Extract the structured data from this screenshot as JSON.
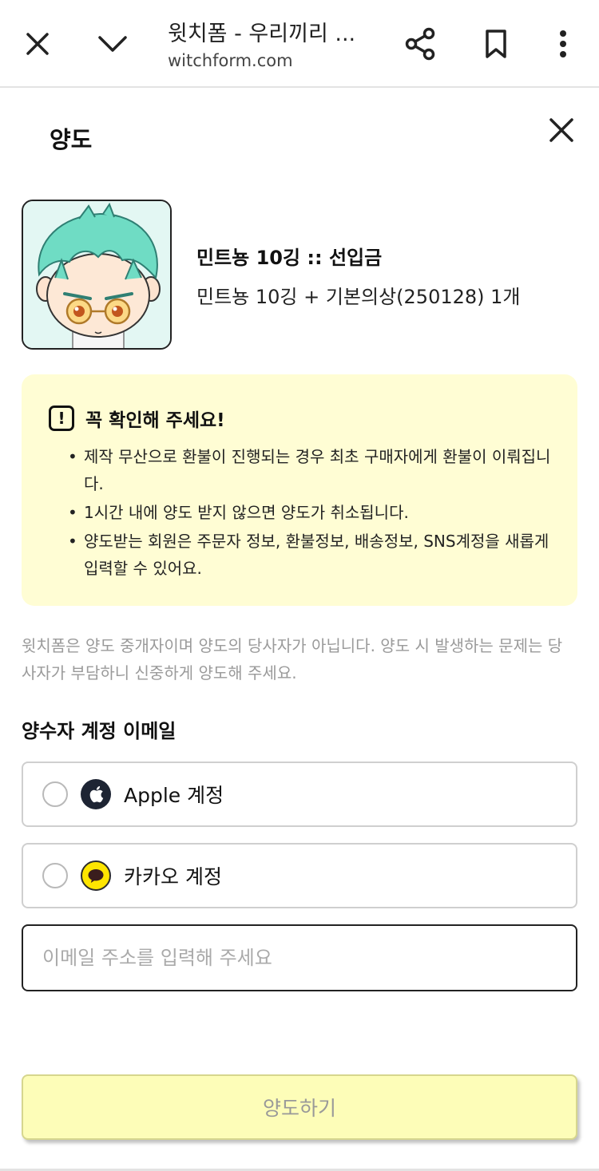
{
  "browser": {
    "title": "윗치폼 - 우리끼리 ...",
    "url": "witchform.com"
  },
  "page": {
    "title": "양도"
  },
  "product": {
    "name": "민트뇽 10깅 :: 선입금",
    "option": "민트뇽 10깅 + 기본의상(250128) 1개"
  },
  "notice": {
    "title": "꼭 확인해 주세요!",
    "items": [
      "제작 무산으로 환불이 진행되는 경우 최초 구매자에게 환불이 이뤄집니다.",
      "1시간 내에 양도 받지 않으면 양도가 취소됩니다.",
      "양도받는 회원은 주문자 정보, 환불정보, 배송정보, SNS계정을 새롭게 입력할 수 있어요."
    ]
  },
  "disclaimer": "윗치폼은 양도 중개자이며 양도의 당사자가 아닙니다. 양도 시 발생하는 문제는 당사자가 부담하니 신중하게 양도해 주세요.",
  "recipient": {
    "label": "양수자 계정 이메일",
    "options": [
      {
        "label": "Apple 계정",
        "icon": "apple-icon"
      },
      {
        "label": "카카오 계정",
        "icon": "kakao-icon"
      }
    ],
    "email_placeholder": "이메일 주소를 입력해 주세요"
  },
  "submit_label": "양도하기",
  "colors": {
    "notice_bg": "#fffdd4",
    "submit_bg": "#fdfdb8",
    "kakao": "#fee500",
    "apple": "#1d2433"
  }
}
